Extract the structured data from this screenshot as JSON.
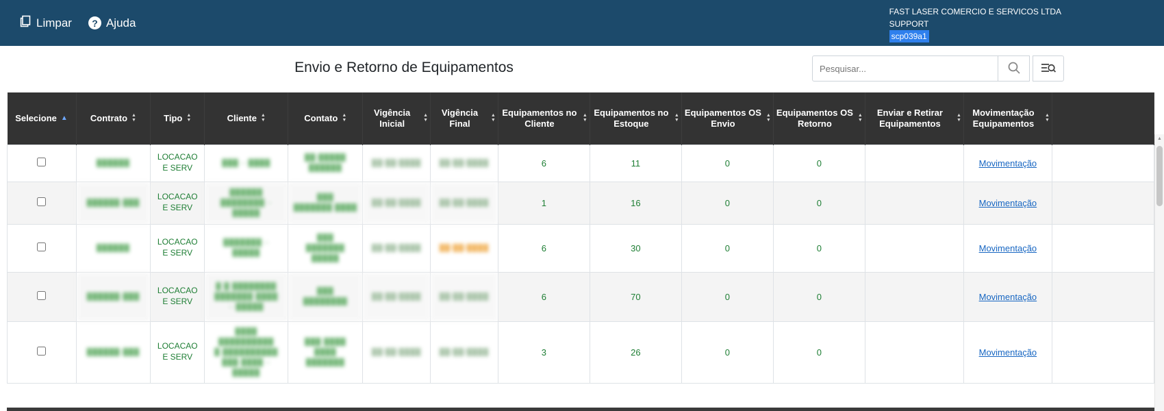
{
  "topbar": {
    "limpar_label": "Limpar",
    "ajuda_label": "Ajuda",
    "ajuda_icon_glyph": "?",
    "company_line1": "FAST LASER COMERCIO E SERVICOS LTDA",
    "company_line2": "SUPPORT",
    "company_line3": "scp039a1"
  },
  "page_title": "Envio e Retorno de Equipamentos",
  "search": {
    "placeholder": "Pesquisar..."
  },
  "icons": {
    "limpar": "copy-page-icon",
    "ajuda": "question-circle-icon",
    "search": "magnifier-icon",
    "advanced_search": "list-magnifier-icon",
    "sort": "sort-arrows-icon",
    "sorted_asc": "sort-up-icon",
    "scroll_up": "arrow-up-icon"
  },
  "colors": {
    "topbar_bg": "#1c4a6b",
    "table_header_bg": "#333333",
    "green_text": "#1e7e34",
    "link_blue": "#1766c2",
    "session_highlight": "#2f80ed",
    "alert_orange": "#f0ad4e",
    "stripe_gray": "#f4f4f4"
  },
  "table": {
    "columns": [
      "Selecione",
      "Contrato",
      "Tipo",
      "Cliente",
      "Contato",
      "Vigência Inicial",
      "Vigência Final",
      "Equipamentos no Cliente",
      "Equipamentos no Estoque",
      "Equipamentos OS Envio",
      "Equipamentos OS Retorno",
      "Enviar e Retirar Equipamentos",
      "Movimentação Equipamentos",
      ""
    ],
    "rows": [
      {
        "contrato": "██████",
        "tipo": "LOCACAO E SERV",
        "cliente": "███ – ████",
        "contato": "██ █████\n██████",
        "vigencia_inicial": "██/██/████",
        "vigencia_final": "██/██/████",
        "equip_cliente": "6",
        "equip_estoque": "11",
        "os_envio": "0",
        "os_retorno": "0",
        "enviar_retirar": "",
        "movimentacao": "Movimentação"
      },
      {
        "contrato": "██████-███",
        "tipo": "LOCACAO E SERV",
        "cliente": "██████\n████████ –\n█████",
        "contato": "███\n███████ ████",
        "vigencia_inicial": "██/██/████",
        "vigencia_final": "██/██/████",
        "equip_cliente": "1",
        "equip_estoque": "16",
        "os_envio": "0",
        "os_retorno": "0",
        "enviar_retirar": "",
        "movimentacao": "Movimentação"
      },
      {
        "contrato": "██████",
        "tipo": "LOCACAO E SERV",
        "cliente": "███████ –\n█████",
        "contato": "███\n███████\n█████",
        "vigencia_inicial": "██/██/████",
        "vigencia_final": "██/██/████",
        "equip_cliente": "6",
        "equip_estoque": "30",
        "os_envio": "0",
        "os_retorno": "0",
        "enviar_retirar": "",
        "movimentacao": "Movimentação"
      },
      {
        "contrato": "██████-███",
        "tipo": "LOCACAO E SERV",
        "cliente": "█ █ ████████\n███████ ████\n– █████",
        "contato": "███\n████████",
        "vigencia_inicial": "██/██/████",
        "vigencia_final": "██/██/████",
        "equip_cliente": "6",
        "equip_estoque": "70",
        "os_envio": "0",
        "os_retorno": "0",
        "enviar_retirar": "",
        "movimentacao": "Movimentação"
      },
      {
        "contrato": "██████-███",
        "tipo": "LOCACAO E SERV",
        "cliente": "████ ██████████\n█ ██████████\n███ ████ –\n█████",
        "contato": "███ ████\n████\n███████",
        "vigencia_inicial": "██/██/████",
        "vigencia_final": "██/██/████",
        "equip_cliente": "3",
        "equip_estoque": "26",
        "os_envio": "0",
        "os_retorno": "0",
        "enviar_retirar": "",
        "movimentacao": "Movimentação"
      }
    ]
  }
}
